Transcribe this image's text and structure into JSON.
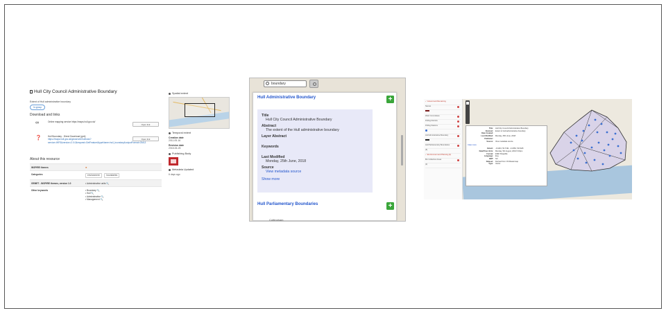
{
  "panel1": {
    "title": "Hull City Council Administrative Boundary",
    "abstract": "Extent of Hull administrative boundary",
    "tag": "hr-group",
    "download_heading": "Download and links",
    "links": [
      {
        "text": "Online mapping service https://maps.hull.gov.uk/",
        "button": "Open link"
      },
      {
        "text": "Hull Boundary - Direct Download (gml)",
        "url": "https://maps.hull.gov.uk/geoserver/hull/ows?service=WFS&version=2.0.0&request=GetFeature&typeName=hull_boundary&outputFormat=GML3",
        "button": "Open link"
      }
    ],
    "about_heading": "About this resource",
    "rows": [
      {
        "key": "INSPIRE themes",
        "value": "✕"
      },
      {
        "key": "Categories",
        "chips": [
          "environment",
          "boundaries"
        ]
      },
      {
        "key": "GEMET - INSPIRE themes, version 1.0",
        "value": "• Administrative units 🔍"
      },
      {
        "key": "Other keywords",
        "list": [
          "• Boundary 🔍",
          "• Hull 🔍",
          "• Administrative 🔍",
          "• Management 🔍"
        ]
      }
    ]
  },
  "panel2": {
    "spatial_extent": "Spatial extent",
    "temporal_extent": "Temporal extent",
    "creation_label": "Creation date",
    "creation_value": "2011-05-16",
    "revision_label": "Revision date",
    "revision_value": "2018-06-25",
    "publishing_label": "Publishing Body",
    "updated_label": "Metadata Updated",
    "updated_value": "6 days ago"
  },
  "panel3": {
    "search_value": "boundary",
    "result1_title": "Hull Administrative Boundary",
    "title_label": "Title",
    "title_value": "Hull City Council Administrative Boundary",
    "abstract_label": "Abstract",
    "abstract_value": "The extent of the Hull administrative boundary",
    "layer_abstract_label": "Layer Abstract",
    "keywords_label": "Keywords",
    "last_modified_label": "Last Modified",
    "last_modified_value": "Monday, 25th June, 2018",
    "source_label": "Source",
    "source_link": "View metadata source",
    "show_more": "Show more",
    "result2_title": "Hull Parliamentary Boundaries",
    "town_label": "Cottingham",
    "add_label": "+"
  },
  "panel4": {
    "sidebar_rows": [
      "✓ Ground and Remaining",
      "Names",
      "",
      "Ward Committees",
      "Polling Districts",
      "Polling Stations",
      "",
      "Hull Administrative Boundary",
      "",
      "Hull Parliamentary Boundaries",
      "(5)",
      "✓ Environment and Planning (4)",
      "Bin Collection Areas",
      "(3)"
    ],
    "info": [
      {
        "k": "Title:",
        "v": "Hull City Council Administrative Boundary"
      },
      {
        "k": "Abstract:",
        "v": "Extent of Hull administrative boundary"
      },
      {
        "k": "Date Created:",
        "v": ""
      },
      {
        "k": "Last Modified:",
        "v": "Monday, 25th June, 2018"
      },
      {
        "k": "Publisher:",
        "v": ""
      },
      {
        "k": "Source:",
        "v": "View metadata source"
      }
    ],
    "clear": "Clear more",
    "info2": [
      {
        "k": "Extent:",
        "v": "-0.4243, 53.7191, -0.2352, 53.8115"
      },
      {
        "k": "Date/Time Units:",
        "v": "Monday, 5th August, 2019 5:33pm"
      },
      {
        "k": "Format:",
        "v": "ESRI Shapefile"
      },
      {
        "k": "Language:",
        "v": "Eng"
      },
      {
        "k": "BBT:",
        "v": "NC"
      },
      {
        "k": "Dataset:",
        "v": "Derived from OS Mastermap"
      },
      {
        "k": "Type:",
        "v": "Vector"
      }
    ]
  }
}
